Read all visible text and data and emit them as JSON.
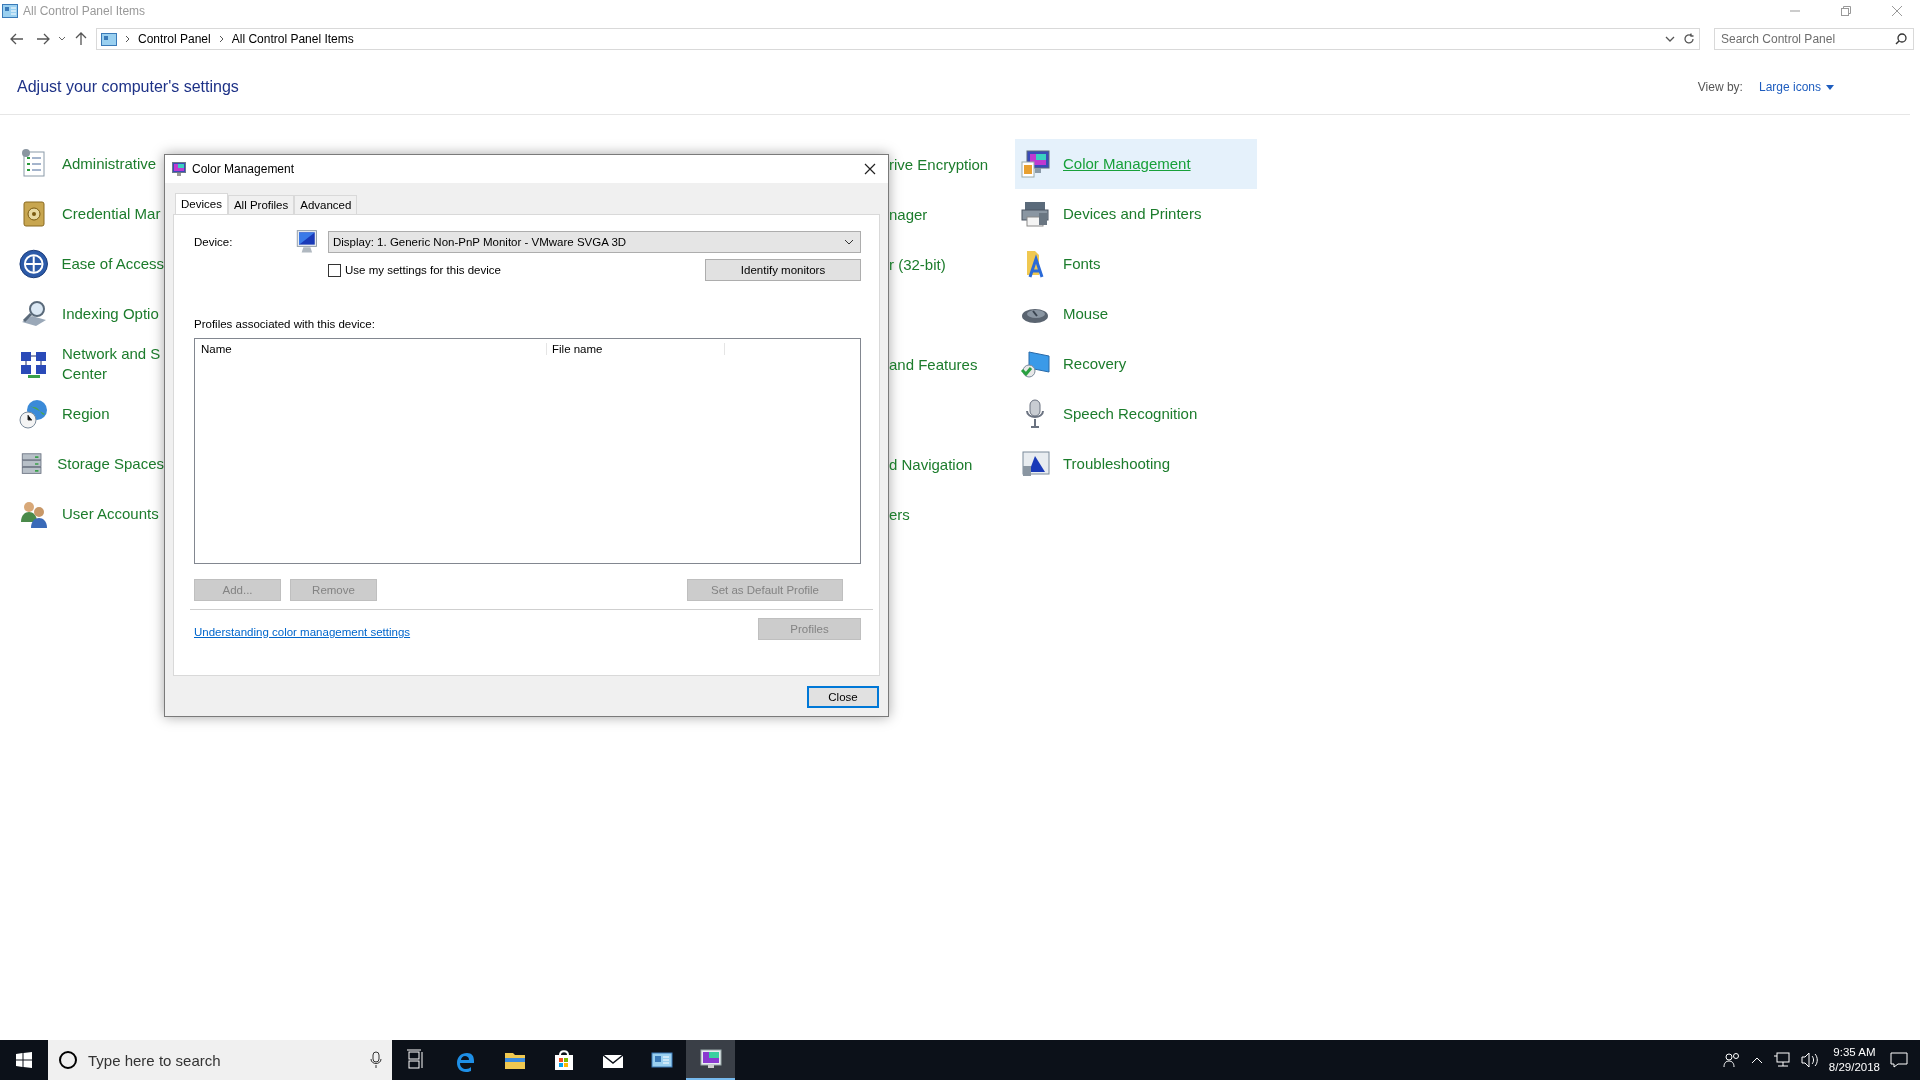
{
  "window": {
    "title": "All Control Panel Items"
  },
  "address_bar": {
    "breadcrumbs": [
      "Control Panel",
      "All Control Panel Items"
    ]
  },
  "search": {
    "placeholder": "Search Control Panel"
  },
  "heading": "Adjust your computer's settings",
  "view_by": {
    "label": "View by:",
    "value": "Large icons"
  },
  "left_column": [
    {
      "label": "Administrative"
    },
    {
      "label": "Credential Mar"
    },
    {
      "label": "Ease of Access"
    },
    {
      "label": "Indexing Optio"
    },
    {
      "label": "Network and S\nCenter"
    },
    {
      "label": "Region"
    },
    {
      "label": "Storage Spaces"
    },
    {
      "label": "User Accounts"
    }
  ],
  "middle_column": [
    {
      "kind": "text",
      "label": "rive Encryption"
    },
    {
      "kind": "text",
      "label": "nager"
    },
    {
      "kind": "text",
      "label": "r (32-bit)"
    },
    {
      "kind": "covered"
    },
    {
      "kind": "text",
      "label": "and Features"
    },
    {
      "kind": "covered"
    },
    {
      "kind": "text",
      "label": "d Navigation"
    },
    {
      "kind": "text",
      "label": "ers"
    }
  ],
  "right_column": [
    {
      "label": "Color Management",
      "selected": true
    },
    {
      "label": "Devices and Printers",
      "selected": false
    },
    {
      "label": "Fonts",
      "selected": false
    },
    {
      "label": "Mouse",
      "selected": false
    },
    {
      "label": "Recovery",
      "selected": false
    },
    {
      "label": "Speech Recognition",
      "selected": false
    },
    {
      "label": "Troubleshooting",
      "selected": false
    }
  ],
  "dialog": {
    "title": "Color Management",
    "tabs": [
      {
        "label": "Devices",
        "selected": true
      },
      {
        "label": "All Profiles",
        "selected": false
      },
      {
        "label": "Advanced",
        "selected": false
      }
    ],
    "device_label": "Device:",
    "device_value": "Display: 1. Generic Non-PnP Monitor - VMware SVGA 3D",
    "use_my_settings": {
      "label": "Use my settings for this device",
      "checked": false
    },
    "identify_button": {
      "label": "Identify monitors",
      "disabled": false
    },
    "profiles_label": "Profiles associated with this device:",
    "columns": [
      "Name",
      "File name"
    ],
    "list_buttons": [
      {
        "label": "Add...",
        "disabled": true
      },
      {
        "label": "Remove",
        "disabled": true
      },
      {
        "label": "Set as Default Profile",
        "disabled": true
      }
    ],
    "link": "Understanding color management settings",
    "profiles_button": {
      "label": "Profiles",
      "disabled": true
    },
    "close_button": {
      "label": "Close",
      "disabled": false
    }
  },
  "taskbar": {
    "search_placeholder": "Type here to search",
    "apps": [
      {
        "selected": false
      },
      {
        "selected": false
      },
      {
        "selected": false
      },
      {
        "selected": false
      },
      {
        "selected": false
      },
      {
        "selected": false
      },
      {
        "selected": true
      }
    ],
    "time": "9:35 AM",
    "date": "8/29/2018"
  }
}
